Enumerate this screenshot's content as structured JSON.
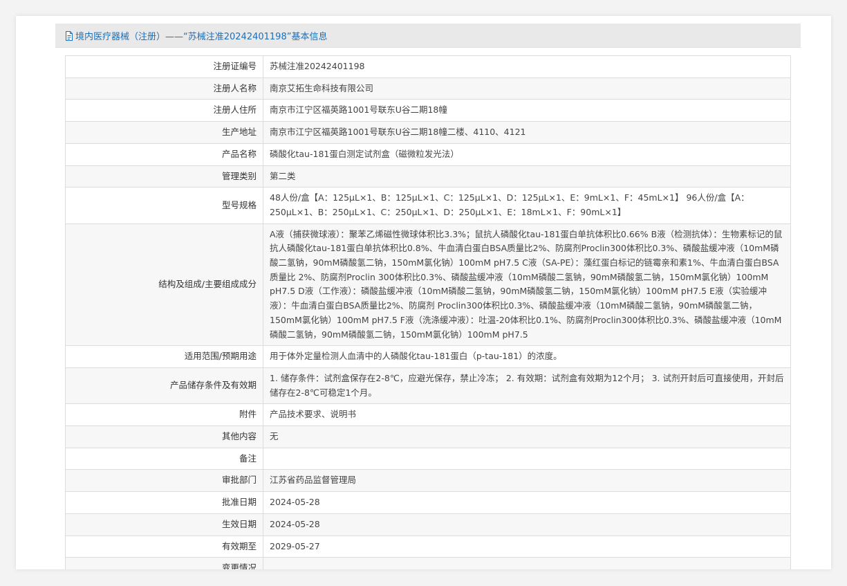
{
  "header": {
    "title": "境内医疗器械（注册）——“苏械注准20242401198”基本信息"
  },
  "rows": [
    {
      "label": "注册证编号",
      "value": "苏械注准20242401198"
    },
    {
      "label": "注册人名称",
      "value": "南京艾拓生命科技有限公司"
    },
    {
      "label": "注册人住所",
      "value": "南京市江宁区福英路1001号联东U谷二期18幢"
    },
    {
      "label": "生产地址",
      "value": "南京市江宁区福英路1001号联东U谷二期18幢二楼、4110、4121"
    },
    {
      "label": "产品名称",
      "value": "磷酸化tau-181蛋白测定试剂盒（磁微粒发光法）"
    },
    {
      "label": "管理类别",
      "value": "第二类"
    },
    {
      "label": "型号规格",
      "value": "48人份/盒【A：125μL×1、B：125μL×1、C：125μL×1、D：125μL×1、E：9mL×1、F：45mL×1】 96人份/盒【A：250μL×1、B：250μL×1、C：250μL×1、D：250μL×1、E：18mL×1、F：90mL×1】"
    },
    {
      "label": "结构及组成/主要组成成分",
      "value": "A液（捕获微球液）：聚苯乙烯磁性微球体积比3.3%；鼠抗人磷酸化tau-181蛋白单抗体积比0.66% B液（检测抗体）：生物素标记的鼠抗人磷酸化tau-181蛋白单抗体积比0.8%、牛血清白蛋白BSA质量比2%、防腐剂Proclin300体积比0.3%、磷酸盐缓冲液（10mM磷酸二氢钠，90mM磷酸氢二钠，150mM氯化钠）100mM pH7.5 C液（SA-PE）：藻红蛋白标记的链霉亲和素1%、牛血清白蛋白BSA质量比 2%、防腐剂Proclin 300体积比0.3%、磷酸盐缓冲液（10mM磷酸二氢钠，90mM磷酸氢二钠，150mM氯化钠）100mM pH7.5 D液（工作液）：磷酸盐缓冲液（10mM磷酸二氢钠，90mM磷酸氢二钠，150mM氯化钠）100mM pH7.5 E液（实验缓冲液）：牛血清白蛋白BSA质量比2%、防腐剂 Proclin300体积比0.3%、磷酸盐缓冲液（10mM磷酸二氢钠，90mM磷酸氢二钠，150mM氯化钠）100mM pH7.5 F液（洗涤缓冲液）：吐温-20体积比0.1%、防腐剂Proclin300体积比0.3%、磷酸盐缓冲液（10mM磷酸二氢钠，90mM磷酸氢二钠，150mM氯化钠）100mM pH7.5"
    },
    {
      "label": "适用范围/预期用途",
      "value": "用于体外定量检测人血清中的人磷酸化tau-181蛋白（p-tau-181）的浓度。"
    },
    {
      "label": "产品储存条件及有效期",
      "value": "1. 储存条件：试剂盒保存在2-8℃，应避光保存，禁止冷冻； 2. 有效期：试剂盒有效期为12个月； 3. 试剂开封后可直接使用，开封后储存在2-8℃可稳定1个月。"
    },
    {
      "label": "附件",
      "value": "产品技术要求、说明书"
    },
    {
      "label": "其他内容",
      "value": "无"
    },
    {
      "label": "备注",
      "value": ""
    },
    {
      "label": "审批部门",
      "value": "江苏省药品监督管理局"
    },
    {
      "label": "批准日期",
      "value": "2024-05-28"
    },
    {
      "label": "生效日期",
      "value": "2024-05-28"
    },
    {
      "label": "有效期至",
      "value": "2029-05-27"
    },
    {
      "label": "变更情况",
      "value": ""
    },
    {
      "label": "",
      "value": ""
    }
  ]
}
